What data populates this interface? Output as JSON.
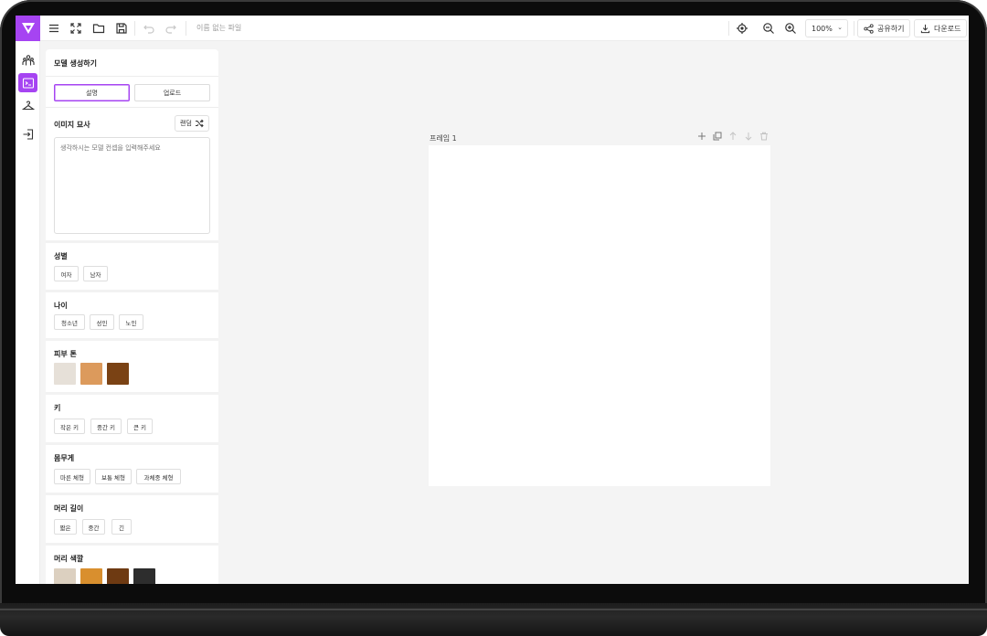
{
  "app": {
    "brand_color": "#a644f2",
    "file_name": "이름 없는 파일"
  },
  "toolbar": {
    "left_icons": [
      "menu-icon",
      "fullscreen-icon",
      "folder-icon",
      "save-icon",
      "undo-icon",
      "redo-icon"
    ],
    "right_icons": [
      "target-icon",
      "zoom-out-icon",
      "zoom-in-icon"
    ],
    "zoom_value": "100%",
    "share_label": "공유하기",
    "download_label": "다운로드"
  },
  "rail": {
    "items": [
      {
        "name": "models-icon",
        "active": false
      },
      {
        "name": "terminal-icon",
        "active": true
      },
      {
        "name": "hanger-icon",
        "active": false
      },
      {
        "name": "exit-icon",
        "active": false
      }
    ]
  },
  "panel": {
    "title": "모델 생성하기",
    "tabs": [
      {
        "label": "설명",
        "active": true
      },
      {
        "label": "업로드",
        "active": false
      }
    ],
    "image_description": {
      "label": "이미지 묘사",
      "random_label": "랜덤",
      "placeholder": "생각하시는 모델 컨셉을 입력해주세요"
    },
    "gender": {
      "label": "성별",
      "options": [
        "여자",
        "남자"
      ]
    },
    "age": {
      "label": "나이",
      "options": [
        "청소년",
        "성인",
        "노인"
      ]
    },
    "skin_tone": {
      "label": "피부 톤",
      "colors": [
        "#e6e0d8",
        "#dc9a5c",
        "#7a4214"
      ]
    },
    "height": {
      "label": "키",
      "options": [
        "작은 키",
        "중간 키",
        "큰 키"
      ]
    },
    "weight": {
      "label": "몸무게",
      "options": [
        "마른 체형",
        "보통 체형",
        "과체중 체형"
      ]
    },
    "hair_length": {
      "label": "머리 길이",
      "options": [
        "짧은",
        "중간",
        "긴"
      ]
    },
    "hair_color": {
      "label": "머리 색깔",
      "colors": [
        "#dcd0c0",
        "#d98f2e",
        "#6e3a12",
        "#2d2d2d"
      ]
    }
  },
  "canvas": {
    "frame_label": "프레임 1",
    "frame_tools": [
      "add-icon",
      "duplicate-icon",
      "move-up-icon",
      "move-down-icon",
      "trash-icon"
    ]
  }
}
